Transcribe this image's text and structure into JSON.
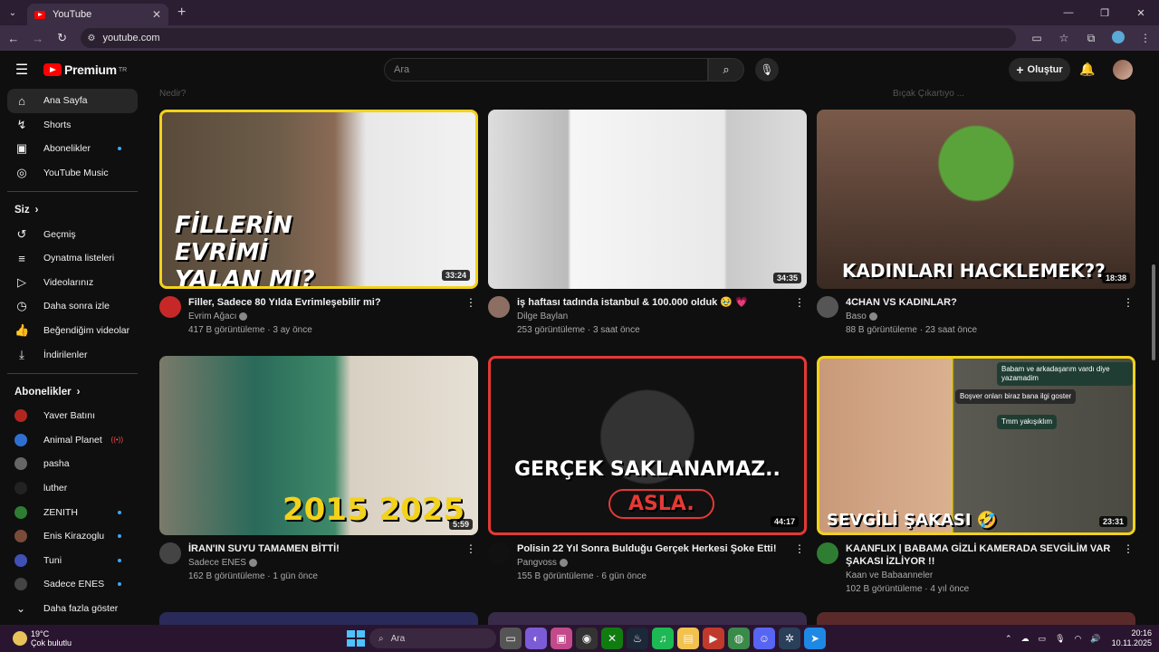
{
  "browser": {
    "tab_title": "YouTube",
    "url": "youtube.com"
  },
  "masthead": {
    "logo_text": "Premium",
    "logo_badge": "TR",
    "search_placeholder": "Ara",
    "create_label": "Oluştur",
    "background_row": [
      "Nedir?",
      "",
      "",
      "Bıçak Çıkartıyo ..."
    ]
  },
  "sidebar": {
    "main": [
      {
        "label": "Ana Sayfa",
        "icon": "home-icon",
        "active": true
      },
      {
        "label": "Shorts",
        "icon": "shorts-icon"
      },
      {
        "label": "Abonelikler",
        "icon": "subscriptions-icon",
        "dot": true
      },
      {
        "label": "YouTube Music",
        "icon": "music-icon"
      }
    ],
    "you_header": "Siz",
    "you": [
      {
        "label": "Geçmiş",
        "icon": "history-icon"
      },
      {
        "label": "Oynatma listeleri",
        "icon": "playlists-icon"
      },
      {
        "label": "Videolarınız",
        "icon": "your-videos-icon"
      },
      {
        "label": "Daha sonra izle",
        "icon": "watch-later-icon"
      },
      {
        "label": "Beğendiğim videolar",
        "icon": "liked-icon"
      },
      {
        "label": "İndirilenler",
        "icon": "download-icon"
      }
    ],
    "subs_header": "Abonelikler",
    "subs": [
      {
        "label": "Yaver Batını",
        "color": "#b3261e"
      },
      {
        "label": "Animal Planet",
        "color": "#2f6fd1",
        "live": true
      },
      {
        "label": "pasha",
        "color": "#666666"
      },
      {
        "label": "luther",
        "color": "#222222"
      },
      {
        "label": "ZENITH",
        "color": "#2e7d32",
        "dot": true
      },
      {
        "label": "Enis Kirazoglu",
        "color": "#7a4b3a",
        "dot": true
      },
      {
        "label": "Tuni",
        "color": "#3f51b5",
        "dot": true
      },
      {
        "label": "Sadece ENES",
        "color": "#444444",
        "dot": true
      },
      {
        "label": "Daha fazla göster",
        "color": ""
      }
    ]
  },
  "videos": [
    {
      "title": "Filler, Sadece 80 Yılda Evrimleşebilir mi?",
      "channel": "Evrim Ağacı",
      "verified": true,
      "stats": "417 B görüntüleme · 3 ay önce",
      "duration": "33:24",
      "overlay": "FİLLERİN EVRİMİ YALAN MI?",
      "av": "#c62828"
    },
    {
      "title": "iş haftası tadında istanbul & 100.000 olduk 🥹 💗",
      "channel": "Dilge Baylan",
      "verified": false,
      "stats": "253 görüntüleme · 3 saat önce",
      "duration": "34:35",
      "overlay": "",
      "av": "#8d6e63"
    },
    {
      "title": "4CHAN VS KADINLAR?",
      "channel": "Baso",
      "verified": true,
      "stats": "88 B görüntüleme · 23 saat önce",
      "duration": "18:38",
      "overlay": "KADINLARI HACKLEMEK??",
      "av": "#555555"
    },
    {
      "title": "İRAN'IN SUYU TAMAMEN BİTTİ!",
      "channel": "Sadece ENES",
      "verified": true,
      "stats": "162 B görüntüleme · 1 gün önce",
      "duration": "5:59",
      "overlay": "2015 2025",
      "av": "#444444"
    },
    {
      "title": "Polisin 22 Yıl Sonra Bulduğu Gerçek Herkesi Şoke Etti!",
      "channel": "Pangvoss",
      "verified": true,
      "stats": "155 B görüntüleme · 6 gün önce",
      "duration": "44:17",
      "overlay": "GERÇEK SAKLANAMAZ..",
      "overlay2": "ASLA.",
      "av": "#111111"
    },
    {
      "title": "KAANFLIX | BABAMA GİZLİ KAMERADA SEVGİLİM VAR ŞAKASI İZLİYOR !!",
      "channel": "Kaan ve Babaanneler",
      "verified": false,
      "stats": "102 B görüntüleme · 4 yıl önce",
      "duration": "23:31",
      "overlay": "SEVGİLİ ŞAKASI 🤣",
      "av": "#2e7d32",
      "chat": [
        "Babam ve arkadaşarım vardı diye yazamadim",
        "Boşver onları biraz bana ilgi goster",
        "Tmm yakışıklım"
      ]
    }
  ],
  "taskbar": {
    "temp": "19°C",
    "weather": "Çok bulutlu",
    "search": "Ara",
    "time": "20:16",
    "date": "10.11.2025"
  }
}
